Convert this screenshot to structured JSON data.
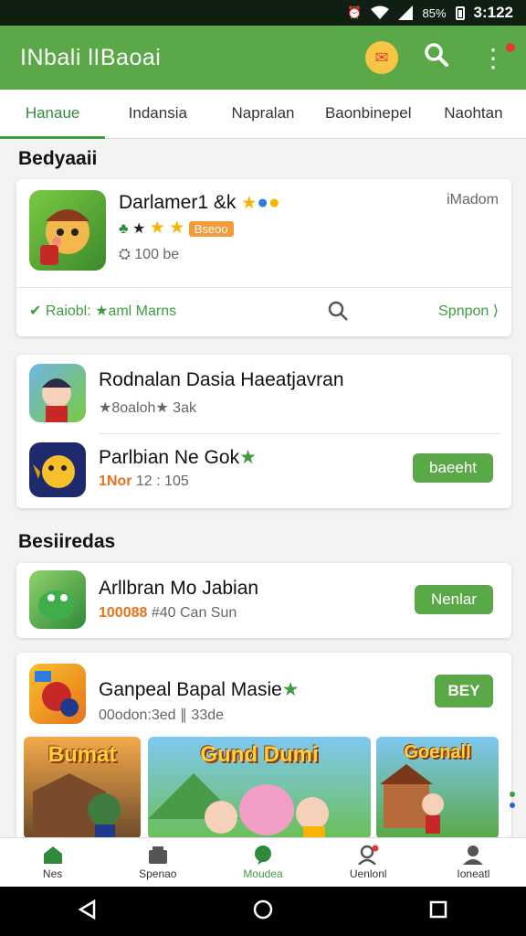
{
  "status": {
    "battery": "85%",
    "time": "3:122"
  },
  "app_bar": {
    "title": "INbali lIBaoai"
  },
  "tabs": [
    {
      "label": "Hanaue",
      "active": true
    },
    {
      "label": "Indansia"
    },
    {
      "label": "Napralan"
    },
    {
      "label": "Baonbinepel"
    },
    {
      "label": "Naohtan"
    }
  ],
  "section1": {
    "heading": "Bedyaaii"
  },
  "featured": {
    "title": "Darlamer1 &k",
    "corner": "iMadom",
    "badge": "Bseoo",
    "size": "100 be",
    "footer_left": "Raiobl: ★aml Marns",
    "footer_right": "Spnpon"
  },
  "list1": [
    {
      "title": "Rodnalan Dasia Haeatjavran",
      "sub": "★8oaloh★ 3ak"
    },
    {
      "title": "Parlbian Ne Gok",
      "sub_orange": "1Nor",
      "sub": "12 : 105",
      "button": "baeeht"
    }
  ],
  "section2": {
    "heading": "Besiiredas"
  },
  "list2": {
    "title": "Arllbran Mo Jabian",
    "sub_orange": "100088",
    "sub": "#40 Can Sun",
    "button": "Nenlar"
  },
  "list3": {
    "title": "Ganpeal Bapal Masie",
    "sub": "00odon:3ed ∥ 33de",
    "button": "BEY",
    "banners": [
      "Bumat",
      "Gund Dumi",
      "Goenall"
    ]
  },
  "bottom_nav": [
    {
      "label": "Nes",
      "icon": "home-icon"
    },
    {
      "label": "Spenao",
      "icon": "store-icon"
    },
    {
      "label": "Moudea",
      "icon": "chat-icon",
      "active": true
    },
    {
      "label": "Uenlonl",
      "icon": "person-alert-icon"
    },
    {
      "label": "Ioneatl",
      "icon": "profile-icon"
    }
  ],
  "colors": {
    "primary": "#5aa847",
    "accent_orange": "#e8731d",
    "star": "#f4b400"
  }
}
